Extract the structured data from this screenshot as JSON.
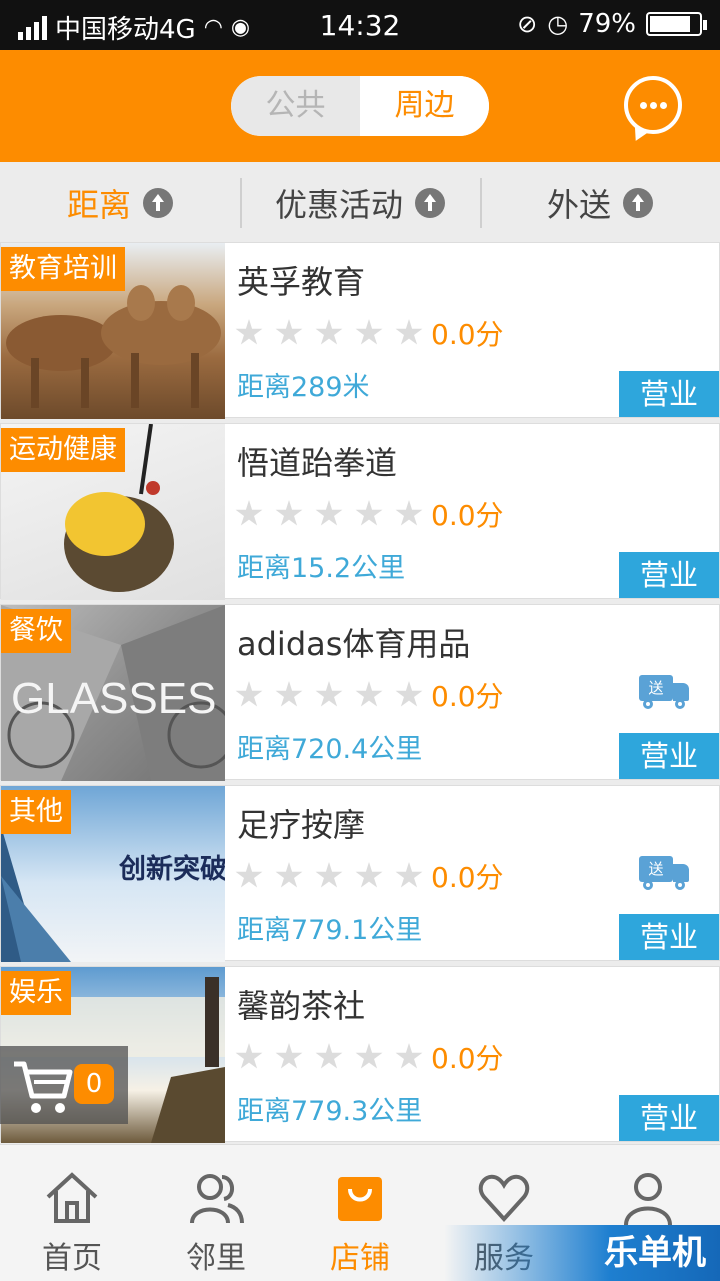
{
  "status_bar": {
    "carrier": "中国移动4G",
    "time": "14:32",
    "battery": "79%"
  },
  "header": {
    "segments": [
      "公共",
      "周边"
    ],
    "selected_segment": "周边"
  },
  "filters": [
    {
      "label": "距离",
      "active": true
    },
    {
      "label": "优惠活动",
      "active": false
    },
    {
      "label": "外送",
      "active": false
    }
  ],
  "shops": [
    {
      "category": "教育培训",
      "name": "英孚教育",
      "score": "0.0分",
      "distance": "距离289米",
      "status": "营业",
      "delivery": false
    },
    {
      "category": "运动健康",
      "name": "悟道跆拳道",
      "score": "0.0分",
      "distance": "距离15.2公里",
      "status": "营业",
      "delivery": false
    },
    {
      "category": "餐饮",
      "name": "adidas体育用品",
      "score": "0.0分",
      "distance": "距离720.4公里",
      "status": "营业",
      "delivery": true,
      "thumb_text": "GLASSES"
    },
    {
      "category": "其他",
      "name": "足疗按摩",
      "score": "0.0分",
      "distance": "距离779.1公里",
      "status": "营业",
      "delivery": true,
      "thumb_text": "创新突破"
    },
    {
      "category": "娱乐",
      "name": "馨韵茶社",
      "score": "0.0分",
      "distance": "距离779.3公里",
      "status": "营业",
      "delivery": false
    }
  ],
  "delivery_badge": "送",
  "cart": {
    "count": "0"
  },
  "nav": [
    {
      "label": "首页",
      "icon": "home-icon",
      "active": false
    },
    {
      "label": "邻里",
      "icon": "people-icon",
      "active": false
    },
    {
      "label": "店铺",
      "icon": "shop-bag-icon",
      "active": true
    },
    {
      "label": "服务",
      "icon": "heart-icon",
      "active": false
    },
    {
      "label": "",
      "icon": "user-icon",
      "active": false
    }
  ],
  "watermark": "乐单机",
  "colors": {
    "accent": "#fd8c00",
    "info": "#2ea6dc",
    "distance": "#3fa9d8"
  }
}
